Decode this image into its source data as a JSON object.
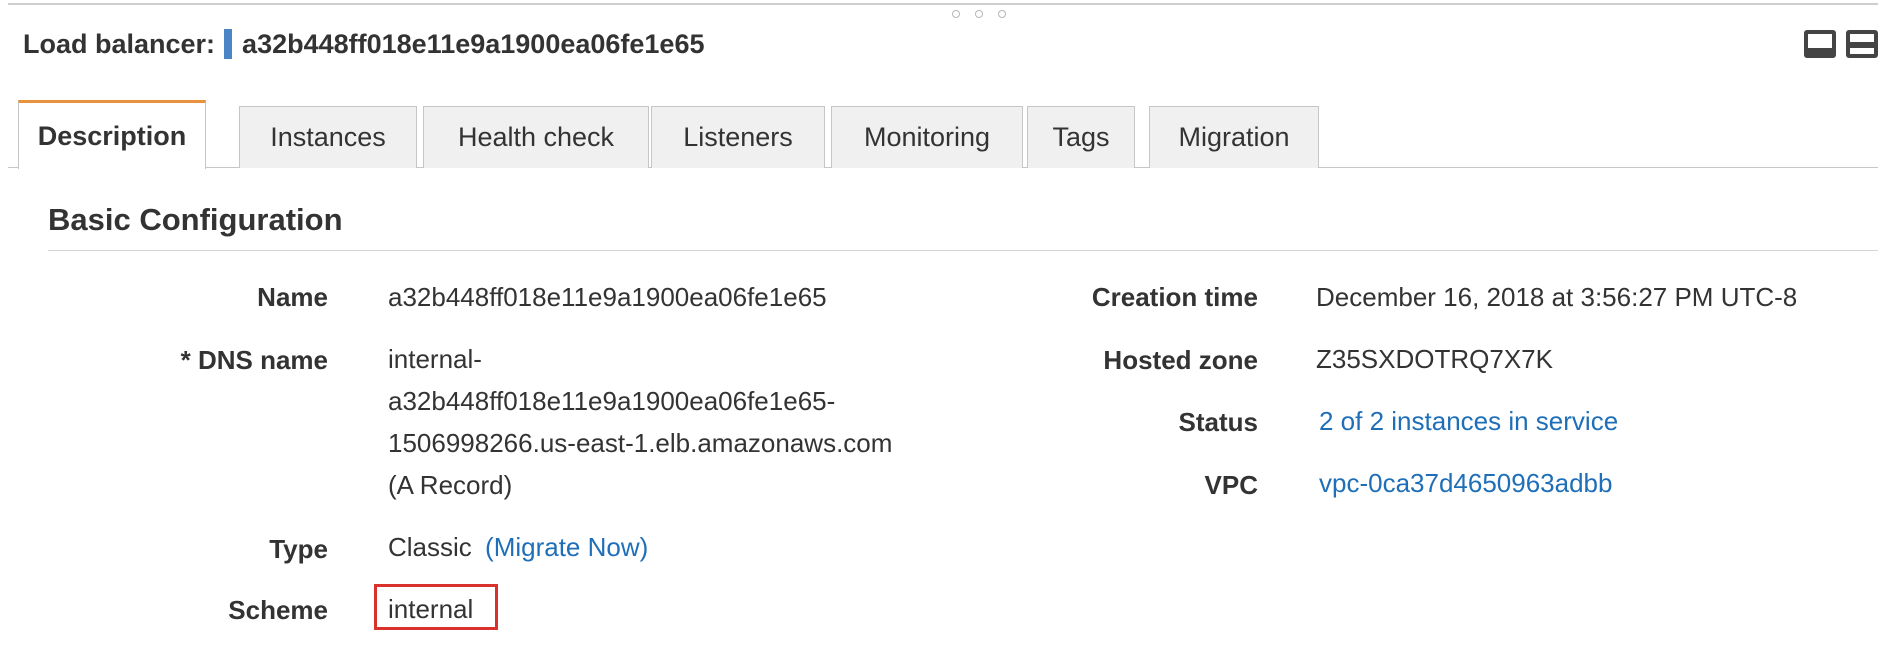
{
  "header": {
    "label": "Load balancer:",
    "name": "a32b448ff018e11e9a1900ea06fe1e65"
  },
  "tabs": [
    {
      "label": "Description",
      "active": true
    },
    {
      "label": "Instances",
      "active": false
    },
    {
      "label": "Health check",
      "active": false
    },
    {
      "label": "Listeners",
      "active": false
    },
    {
      "label": "Monitoring",
      "active": false
    },
    {
      "label": "Tags",
      "active": false
    },
    {
      "label": "Migration",
      "active": false
    }
  ],
  "section": {
    "title": "Basic Configuration"
  },
  "fields": {
    "name": {
      "label": "Name",
      "value": "a32b448ff018e11e9a1900ea06fe1e65"
    },
    "dns": {
      "label": "* DNS name",
      "lines": [
        "internal-",
        "a32b448ff018e11e9a1900ea06fe1e65-",
        "1506998266.us-east-1.elb.amazonaws.com",
        "(A Record)"
      ]
    },
    "type": {
      "label": "Type",
      "value": "Classic",
      "link": "(Migrate Now)"
    },
    "scheme": {
      "label": "Scheme",
      "value": "internal"
    },
    "creation_time": {
      "label": "Creation time",
      "value": "December 16, 2018 at 3:56:27 PM UTC-8"
    },
    "hosted_zone": {
      "label": "Hosted zone",
      "value": "Z35SXDOTRQ7X7K"
    },
    "status": {
      "label": "Status",
      "value": "2 of 2 instances in service"
    },
    "vpc": {
      "label": "VPC",
      "value": "vpc-0ca37d4650963adbb"
    }
  },
  "colors": {
    "active_tab_accent": "#e8923d",
    "link": "#1f6fb8",
    "highlight_box": "#d9312b",
    "selection_marker": "#4a86c5"
  },
  "icons": {
    "splitter": "drag-handle-icon",
    "window_buttons": [
      "panel-minimize-icon",
      "panel-restore-icon"
    ]
  }
}
